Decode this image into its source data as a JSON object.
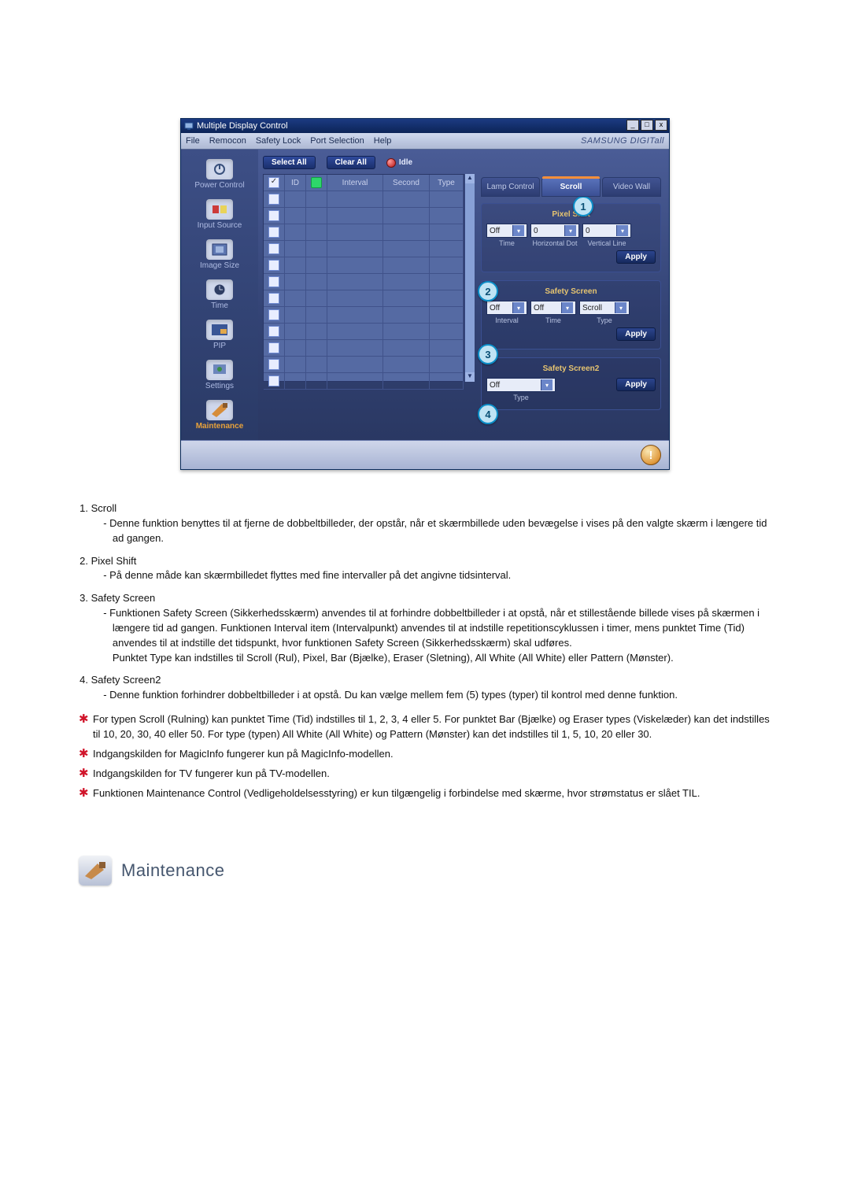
{
  "app": {
    "title": "Multiple Display Control",
    "brand": "SAMSUNG DIGITall",
    "menu": [
      "File",
      "Remocon",
      "Safety Lock",
      "Port Selection",
      "Help"
    ],
    "actions": {
      "select_all": "Select All",
      "clear_all": "Clear All",
      "idle": "Idle"
    },
    "sidebar": [
      {
        "id": "power",
        "label": "Power Control"
      },
      {
        "id": "input",
        "label": "Input Source"
      },
      {
        "id": "image",
        "label": "Image Size"
      },
      {
        "id": "time",
        "label": "Time"
      },
      {
        "id": "pip",
        "label": "PIP"
      },
      {
        "id": "settings",
        "label": "Settings"
      },
      {
        "id": "maintenance",
        "label": "Maintenance",
        "active": true
      }
    ],
    "grid": {
      "headers": {
        "cb": "☑",
        "id": "ID",
        "on": " ",
        "interval": "Interval",
        "second": "Second",
        "type": "Type"
      },
      "first_checked": true,
      "row_count": 12
    },
    "right": {
      "tabs": [
        "Lamp Control",
        "Scroll",
        "Video Wall"
      ],
      "active_tab": 1,
      "pixel_shift": {
        "title": "Pixel Shift",
        "time": {
          "value": "Off",
          "label": "Time"
        },
        "hdot": {
          "value": "0",
          "label": "Horizontal Dot"
        },
        "vline": {
          "value": "0",
          "label": "Vertical Line"
        },
        "apply": "Apply"
      },
      "safety_screen": {
        "title": "Safety Screen",
        "interval": {
          "value": "Off",
          "label": "Interval"
        },
        "time": {
          "value": "Off",
          "label": "Time"
        },
        "type": {
          "value": "Scroll",
          "label": "Type"
        },
        "apply": "Apply"
      },
      "safety_screen2": {
        "title": "Safety Screen2",
        "type": {
          "value": "Off",
          "label": "Type"
        },
        "apply": "Apply"
      }
    },
    "callouts": {
      "c1": "1",
      "c2": "2",
      "c3": "3",
      "c4": "4"
    }
  },
  "notes": {
    "items": [
      {
        "title": "Scroll",
        "body": "Denne funktion benyttes til at fjerne de dobbeltbilleder, der opstår, når et skærmbillede uden bevægelse i vises på den valgte skærm i længere tid ad gangen."
      },
      {
        "title": "Pixel Shift",
        "body": "På denne måde kan skærmbilledet flyttes med fine intervaller på det angivne tidsinterval."
      },
      {
        "title": "Safety Screen",
        "body": "Funktionen Safety Screen (Sikkerhedsskærm) anvendes til at forhindre dobbeltbilleder i at opstå, når et stillestående billede vises på skærmen i længere tid ad gangen.  Funktionen Interval item (Intervalpunkt) anvendes til at indstille repetitionscyklussen i timer, mens punktet Time (Tid) anvendes til at indstille det tidspunkt, hvor funktionen Safety Screen (Sikkerhedsskærm) skal udføres.\nPunktet Type kan indstilles til Scroll (Rul), Pixel, Bar (Bjælke), Eraser (Sletning), All White (All White) eller Pattern (Mønster)."
      },
      {
        "title": "Safety Screen2",
        "body": "Denne funktion forhindrer dobbeltbilleder i at opstå. Du kan vælge mellem fem (5) types (typer) til kontrol med denne funktion."
      }
    ],
    "stars": [
      "For typen Scroll (Rulning) kan punktet Time (Tid) indstilles til 1, 2, 3, 4 eller 5. For punktet Bar (Bjælke) og Eraser types (Viskelæder) kan det indstilles til 10, 20, 30, 40 eller 50. For type (typen) All White (All White) og Pattern (Mønster) kan det indstilles til 1, 5, 10, 20 eller 30.",
      "Indgangskilden for MagicInfo fungerer kun på MagicInfo-modellen.",
      "Indgangskilden for TV fungerer kun på TV-modellen.",
      "Funktionen Maintenance Control (Vedligeholdelsesstyring) er kun tilgængelig i forbindelse med skærme, hvor strømstatus er slået TIL."
    ]
  },
  "section": {
    "title": "Maintenance"
  }
}
